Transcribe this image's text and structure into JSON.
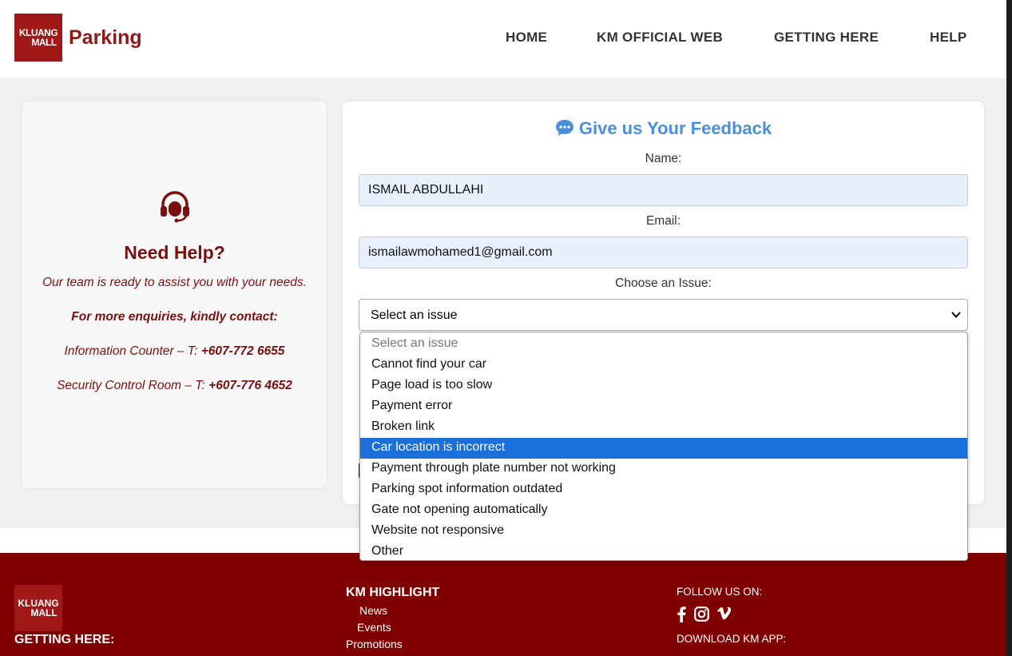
{
  "header": {
    "logo_line1": "KLUANG",
    "logo_line2": "MALL",
    "brand": "Parking",
    "nav": [
      "HOME",
      "KM OFFICIAL WEB",
      "GETTING HERE",
      "HELP"
    ]
  },
  "help": {
    "icon": "headset-icon",
    "title": "Need Help?",
    "subtitle": "Our team is ready to assist you with your needs.",
    "enquiries": "For more enquiries, kindly contact:",
    "info_label": "Information Counter – T: ",
    "info_phone": "+607-772 6655",
    "security_label": "Security Control Room – T: ",
    "security_phone": "+607-776 4652"
  },
  "feedback": {
    "title": "Give us Your Feedback",
    "icon": "chat-bubble-icon",
    "name_label": "Name:",
    "name_value": "ISMAIL ABDULLAHI",
    "email_label": "Email:",
    "email_value": "ismailawmohamed1@gmail.com",
    "issue_label": "Choose an Issue:",
    "issue_selected": "Select an issue",
    "issue_options": [
      "Select an issue",
      "Cannot find your car",
      "Page load is too slow",
      "Payment error",
      "Broken link",
      "Car location is incorrect",
      "Payment through plate number not working",
      "Parking spot information outdated",
      "Gate not opening automatically",
      "Website not responsive",
      "Other"
    ],
    "highlighted_option": "Car location is incorrect"
  },
  "footer": {
    "logo_line1": "KLUANG",
    "logo_line2": "MALL",
    "getting_here": "GETTING HERE:",
    "highlight_title": "KM HIGHLIGHT",
    "highlight_links": [
      "News",
      "Events",
      "Promotions"
    ],
    "follow": "FOLLOW US ON:",
    "social": [
      "facebook-icon",
      "instagram-icon",
      "vimeo-icon"
    ],
    "download": "DOWNLOAD KM APP:"
  },
  "colors": {
    "brand": "#8b1a1a",
    "accent_blue": "#4a90d9",
    "footer_bg": "#800000",
    "highlight": "#1a6fd9"
  }
}
